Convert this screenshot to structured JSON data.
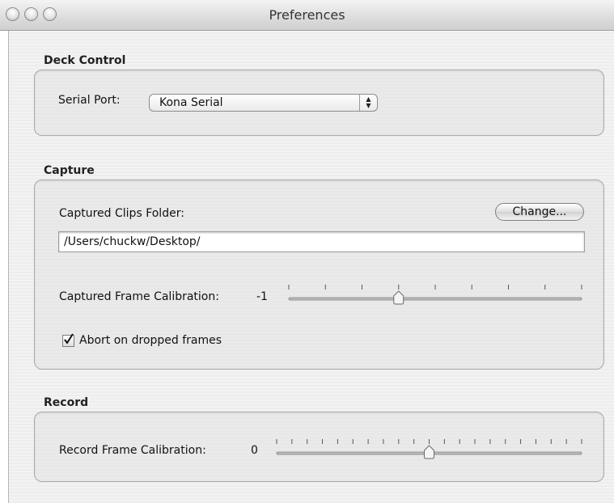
{
  "window": {
    "title": "Preferences"
  },
  "deck_control": {
    "section_title": "Deck Control",
    "serial_port_label": "Serial Port:",
    "serial_port_value": "Kona Serial"
  },
  "capture": {
    "section_title": "Capture",
    "folder_label": "Captured Clips Folder:",
    "change_button": "Change...",
    "folder_path": "/Users/chuckw/Desktop/",
    "frame_calibration_label": "Captured Frame Calibration:",
    "frame_calibration_value": "-1",
    "frame_calibration_ticks": 9,
    "frame_calibration_position": 0.375,
    "abort_label": "Abort on dropped frames",
    "abort_checked": true
  },
  "record": {
    "section_title": "Record",
    "frame_calibration_label": "Record Frame Calibration:",
    "frame_calibration_value": "0",
    "frame_calibration_ticks": 21,
    "frame_calibration_position": 0.5
  }
}
